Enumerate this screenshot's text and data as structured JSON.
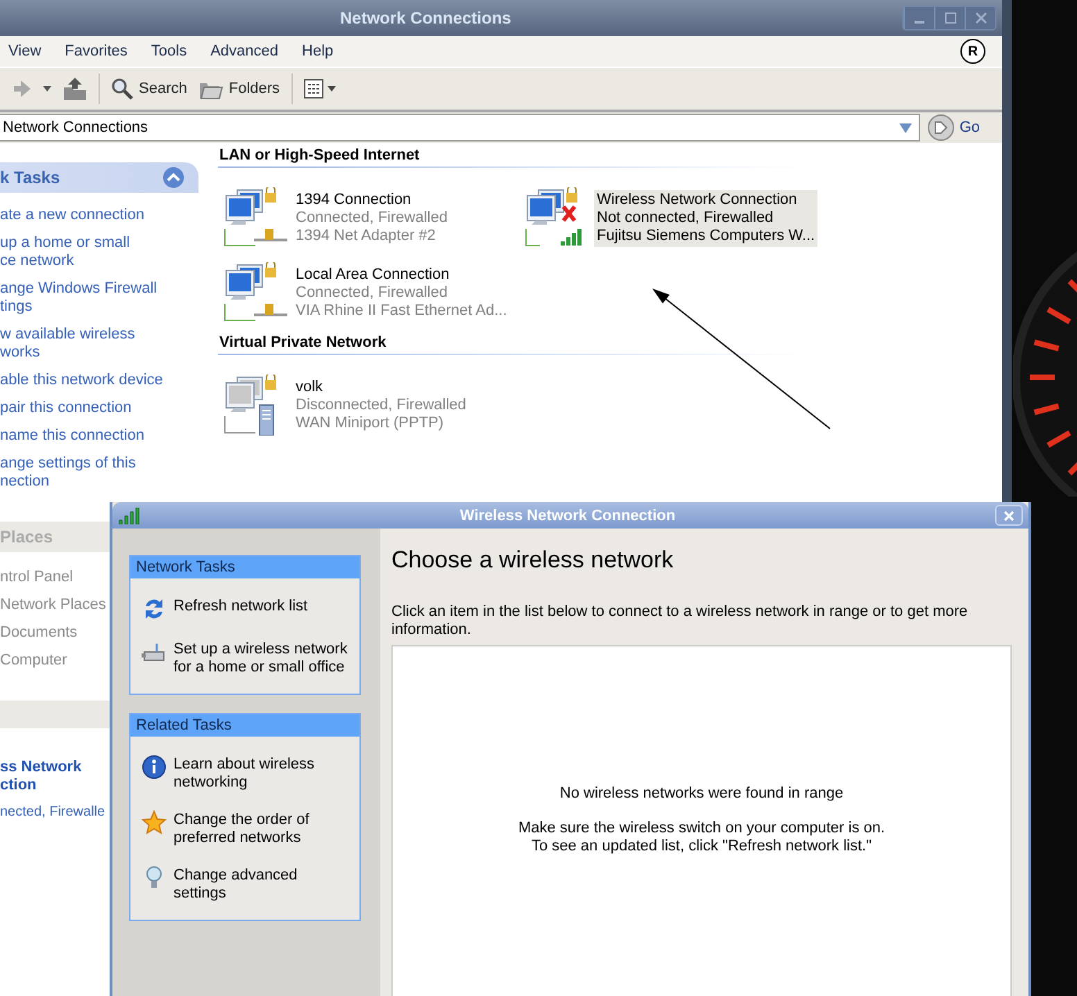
{
  "main_window": {
    "title": "Network Connections",
    "menu": [
      "View",
      "Favorites",
      "Tools",
      "Advanced",
      "Help"
    ],
    "brand_mark": "R",
    "toolbar": [
      {
        "kind": "search",
        "label": "Search"
      },
      {
        "kind": "folders",
        "label": "Folders"
      }
    ],
    "address": {
      "value": "Network Connections",
      "go_label": "Go"
    },
    "sidebar": [
      {
        "kind": "tasks",
        "title": "k Tasks",
        "items": [
          {
            "lines": [
              "ate a new connection"
            ]
          },
          {
            "lines": [
              "up a home or small",
              "ce network"
            ]
          },
          {
            "lines": [
              "ange Windows Firewall",
              "tings"
            ]
          },
          {
            "lines": [
              "w available wireless",
              "works"
            ]
          },
          {
            "lines": [
              "able this network device"
            ]
          },
          {
            "lines": [
              "pair this connection"
            ]
          },
          {
            "lines": [
              "name this connection"
            ]
          },
          {
            "lines": [
              "ange settings of this",
              "nection"
            ]
          }
        ]
      },
      {
        "kind": "places",
        "title": "Places",
        "items": [
          {
            "lines": [
              "ntrol Panel"
            ]
          },
          {
            "lines": [
              "Network Places"
            ]
          },
          {
            "lines": [
              "Documents"
            ]
          },
          {
            "lines": [
              "Computer"
            ]
          }
        ]
      },
      {
        "kind": "details",
        "items": [
          {
            "kind": "name",
            "lines": [
              "ss Network",
              "ction"
            ]
          },
          {
            "kind": "status",
            "lines": [
              "nected, Firewalle"
            ]
          }
        ]
      }
    ],
    "sections": [
      {
        "title": "LAN or High-Speed Internet",
        "connections": [
          {
            "kind": "lan",
            "name": "1394 Connection",
            "status": "Connected, Firewalled",
            "device": "1394 Net Adapter #2",
            "selected": false
          },
          {
            "kind": "wireless",
            "name": "Wireless Network Connection",
            "status": "Not connected, Firewalled",
            "device": "Fujitsu Siemens Computers W...",
            "selected": true
          },
          {
            "kind": "lan",
            "name": "Local Area Connection",
            "status": "Connected, Firewalled",
            "device": "VIA Rhine II Fast Ethernet Ad...",
            "selected": false
          }
        ]
      },
      {
        "title": "Virtual Private Network",
        "connections": [
          {
            "kind": "vpn",
            "name": "volk",
            "status": "Disconnected, Firewalled",
            "device": "WAN Miniport (PPTP)",
            "selected": false
          }
        ]
      }
    ]
  },
  "dialog": {
    "title": "Wireless Network Connection",
    "panels": [
      {
        "title": "Network Tasks",
        "items": [
          {
            "kind": "refresh",
            "lines": [
              "Refresh network list"
            ]
          },
          {
            "kind": "setup",
            "lines": [
              "Set up a wireless network",
              "for a home or small office"
            ]
          }
        ]
      },
      {
        "title": "Related Tasks",
        "items": [
          {
            "kind": "info",
            "lines": [
              "Learn about wireless",
              "networking"
            ]
          },
          {
            "kind": "star",
            "lines": [
              "Change the order of",
              "preferred networks"
            ]
          },
          {
            "kind": "settings",
            "lines": [
              "Change advanced",
              "settings"
            ]
          }
        ]
      }
    ],
    "heading": "Choose a wireless network",
    "description": "Click an item in the list below to connect to a wireless network in range or to get more information.",
    "empty_title": "No wireless networks were found in range",
    "empty_hint": [
      "Make sure the wireless switch on your computer is on.",
      "To see an updated list, click \"Refresh network list.\""
    ]
  }
}
